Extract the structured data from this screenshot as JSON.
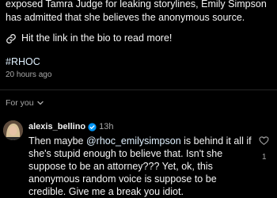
{
  "post": {
    "caption_lines": [
      "exposed Tamra Judge for leaking storylines, Emily Simpson",
      "has admitted that she believes the anonymous source."
    ],
    "cta": "Hit the link in the bio to read more!",
    "hashtag": "#RHOC",
    "timestamp": "20 hours ago"
  },
  "comments_section": {
    "label": "For you"
  },
  "comment": {
    "username": "alexis_bellino",
    "time": "13h",
    "line1_prefix": "Then maybe ",
    "line1_mention": "@rhoc_emilysimpson",
    "line1_suffix": " is behind it all if",
    "lines": [
      "she's stupid enough to believe that. Isn't she",
      "suppose to be an attorney??? Yet, ok, this",
      "anonymous random voice is suppose to be",
      "credible. Give me a break you idiot."
    ],
    "like_count": "1"
  },
  "icons": {
    "link": "link-icon",
    "chevron": "chevron-down-icon",
    "verified": "verified-badge-icon",
    "like": "heart-icon"
  },
  "colors": {
    "background": "#000000",
    "text": "#f5f5f5",
    "secondary": "#a8a8a8",
    "link": "#e0f1ff",
    "verified": "#0095f6"
  }
}
